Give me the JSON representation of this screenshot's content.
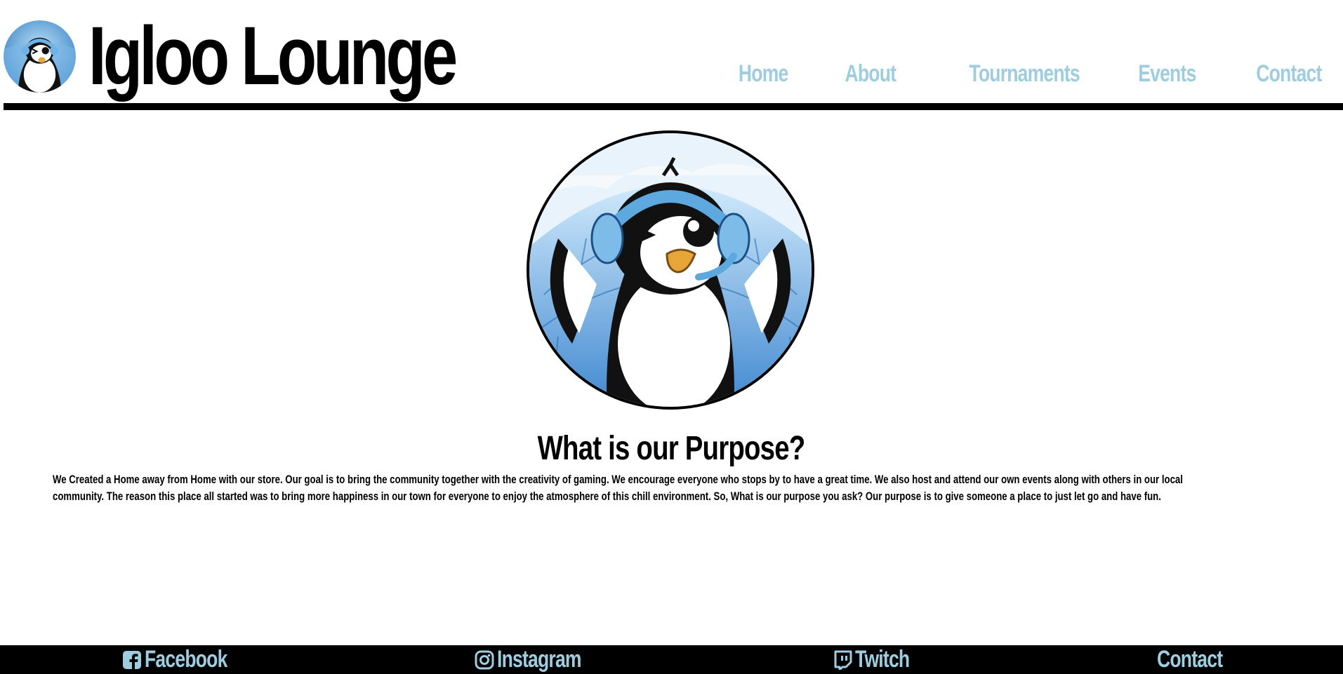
{
  "brand": {
    "title": "Igloo Lounge",
    "logo_icon": "penguin-mascot-logo"
  },
  "nav": {
    "items": [
      {
        "label": "Home"
      },
      {
        "label": "About"
      },
      {
        "label": "Tournaments"
      },
      {
        "label": "Events"
      },
      {
        "label": "Contact"
      }
    ]
  },
  "hero": {
    "image_icon": "penguin-headset-igloo"
  },
  "purpose": {
    "heading": "What is our Purpose?",
    "body": "We Created a Home away from Home with our store. Our goal is to bring the community together with the creativity of gaming. We encourage everyone who stops by to have a great time. We also host and attend our own events along with others in our local community. The reason this place all started was to bring more happiness in our town for everyone to enjoy the atmosphere of this chill environment. So, What is our purpose you ask? Our purpose is to give someone a place to just let go and have fun."
  },
  "footer": {
    "facebook": {
      "label": "Facebook",
      "icon": "facebook-icon"
    },
    "instagram": {
      "label": "Instagram",
      "icon": "instagram-icon"
    },
    "twitch": {
      "label": "Twitch",
      "icon": "twitch-icon"
    },
    "contact": {
      "label": "Contact"
    }
  },
  "colors": {
    "accent": "#9ecde0",
    "text": "#000000",
    "background": "#ffffff",
    "footer_bg": "#000000"
  }
}
